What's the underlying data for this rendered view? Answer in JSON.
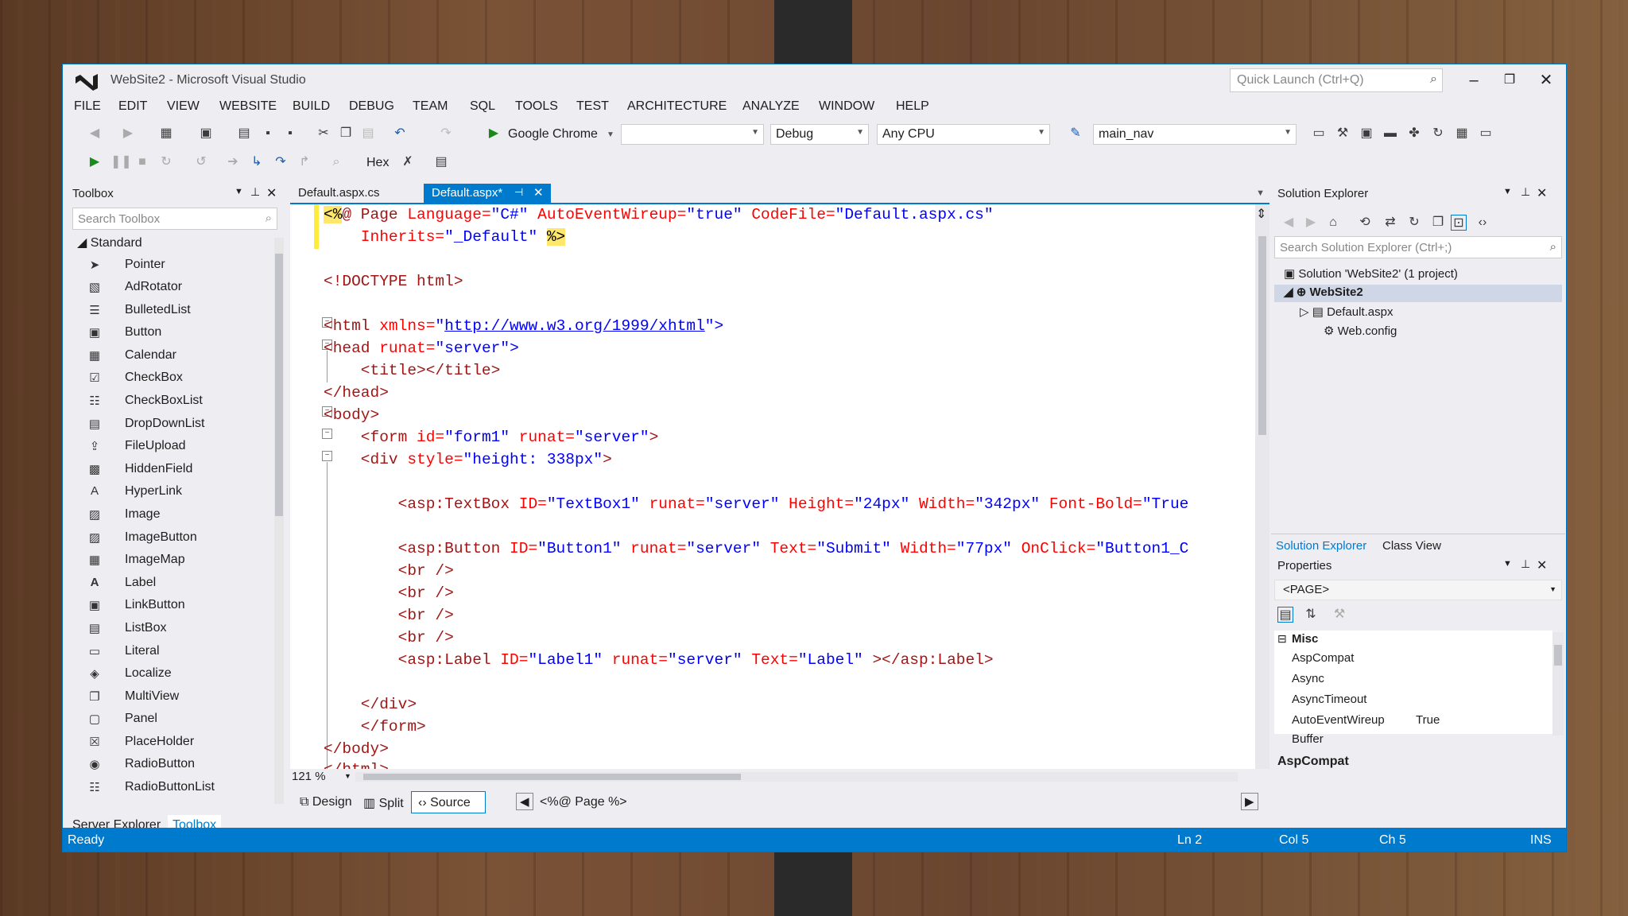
{
  "window": {
    "title": "WebSite2 - Microsoft Visual Studio",
    "quick_launch_placeholder": "Quick Launch (Ctrl+Q)"
  },
  "menu": [
    "FILE",
    "EDIT",
    "VIEW",
    "WEBSITE",
    "BUILD",
    "DEBUG",
    "TEAM",
    "SQL",
    "TOOLS",
    "TEST",
    "ARCHITECTURE",
    "ANALYZE",
    "WINDOW",
    "HELP"
  ],
  "toolbar": {
    "run_target": "Google Chrome",
    "config": "Debug",
    "platform": "Any CPU",
    "nav_combo": "main_nav",
    "hex_label": "Hex"
  },
  "toolbox": {
    "title": "Toolbox",
    "search_placeholder": "Search Toolbox",
    "category": "Standard",
    "items": [
      "Pointer",
      "AdRotator",
      "BulletedList",
      "Button",
      "Calendar",
      "CheckBox",
      "CheckBoxList",
      "DropDownList",
      "FileUpload",
      "HiddenField",
      "HyperLink",
      "Image",
      "ImageButton",
      "ImageMap",
      "Label",
      "LinkButton",
      "ListBox",
      "Literal",
      "Localize",
      "MultiView",
      "Panel",
      "PlaceHolder",
      "RadioButton",
      "RadioButtonList"
    ],
    "bottom_tabs": [
      "Server Explorer",
      "Toolbox"
    ]
  },
  "editor": {
    "tabs": [
      "Default.aspx.cs",
      "Default.aspx*"
    ],
    "zoom": "121 %",
    "views": [
      "Design",
      "Split",
      "Source"
    ],
    "breadcrumb": "<%@ Page %>",
    "code": {
      "l1_a": "<%",
      "l1_b": "@ Page",
      "l1_c": " Language=",
      "l1_d": "\"C#\"",
      "l1_e": " AutoEventWireup=",
      "l1_f": "\"true\"",
      "l1_g": " CodeFile=",
      "l1_h": "\"Default.aspx.cs\"",
      "l2_a": "    Inherits=",
      "l2_b": "\"_Default\"",
      "l2_c": "%>",
      "l3": "<!DOCTYPE html>",
      "l4_a": "<html",
      "l4_b": " xmlns=",
      "l4_c": "\"",
      "l4_d": "http://www.w3.org/1999/xhtml",
      "l4_e": "\">",
      "l5_a": "<head",
      "l5_b": " runat=",
      "l5_c": "\"server\"",
      "l5_d": ">",
      "l6": "    <title></title>",
      "l7": "</head>",
      "l8": "<body>",
      "l9_a": "    <form",
      "l9_b": " id=",
      "l9_c": "\"form1\"",
      "l9_d": " runat=",
      "l9_e": "\"server\"",
      "l9_f": ">",
      "l10_a": "    <div",
      "l10_b": " style=",
      "l10_c": "\"height: 338px\"",
      "l10_d": ">",
      "l11_a": "        <asp:TextBox",
      "l11_b": " ID=",
      "l11_c": "\"TextBox1\"",
      "l11_d": " runat=",
      "l11_e": "\"server\"",
      "l11_f": " Height=",
      "l11_g": "\"24px\"",
      "l11_h": " Width=",
      "l11_i": "\"342px\"",
      "l11_j": " Font-Bold=",
      "l11_k": "\"True",
      "l12_a": "        <asp:Button",
      "l12_b": " ID=",
      "l12_c": "\"Button1\"",
      "l12_d": " runat=",
      "l12_e": "\"server\"",
      "l12_f": " Text=",
      "l12_g": "\"Submit\"",
      "l12_h": " Width=",
      "l12_i": "\"77px\"",
      "l12_j": " OnClick=",
      "l12_k": "\"Button1_C",
      "br": "        <br />",
      "l17_a": "        <asp:Label",
      "l17_b": " ID=",
      "l17_c": "\"Label1\"",
      "l17_d": " runat=",
      "l17_e": "\"server\"",
      "l17_f": " Text=",
      "l17_g": "\"Label\"",
      "l17_h": " ></asp:Label>",
      "l18": "    </div>",
      "l19": "    </form>",
      "l20": "</body>",
      "l21": "</html>"
    }
  },
  "solution_explorer": {
    "title": "Solution Explorer",
    "search_placeholder": "Search Solution Explorer (Ctrl+;)",
    "solution": "Solution 'WebSite2' (1 project)",
    "project": "WebSite2",
    "files": [
      "Default.aspx",
      "Web.config"
    ],
    "tabs": [
      "Solution Explorer",
      "Class View"
    ]
  },
  "properties": {
    "title": "Properties",
    "object": "<PAGE>",
    "category": "Misc",
    "rows": [
      {
        "name": "AspCompat",
        "value": ""
      },
      {
        "name": "Async",
        "value": ""
      },
      {
        "name": "AsyncTimeout",
        "value": ""
      },
      {
        "name": "AutoEventWireup",
        "value": "True"
      },
      {
        "name": "Buffer",
        "value": ""
      }
    ],
    "description_title": "AspCompat"
  },
  "status": {
    "state": "Ready",
    "ln": "Ln 2",
    "col": "Col 5",
    "ch": "Ch 5",
    "mode": "INS"
  },
  "colors": {
    "accent": "#007acc",
    "status_bar": "#007acc"
  }
}
